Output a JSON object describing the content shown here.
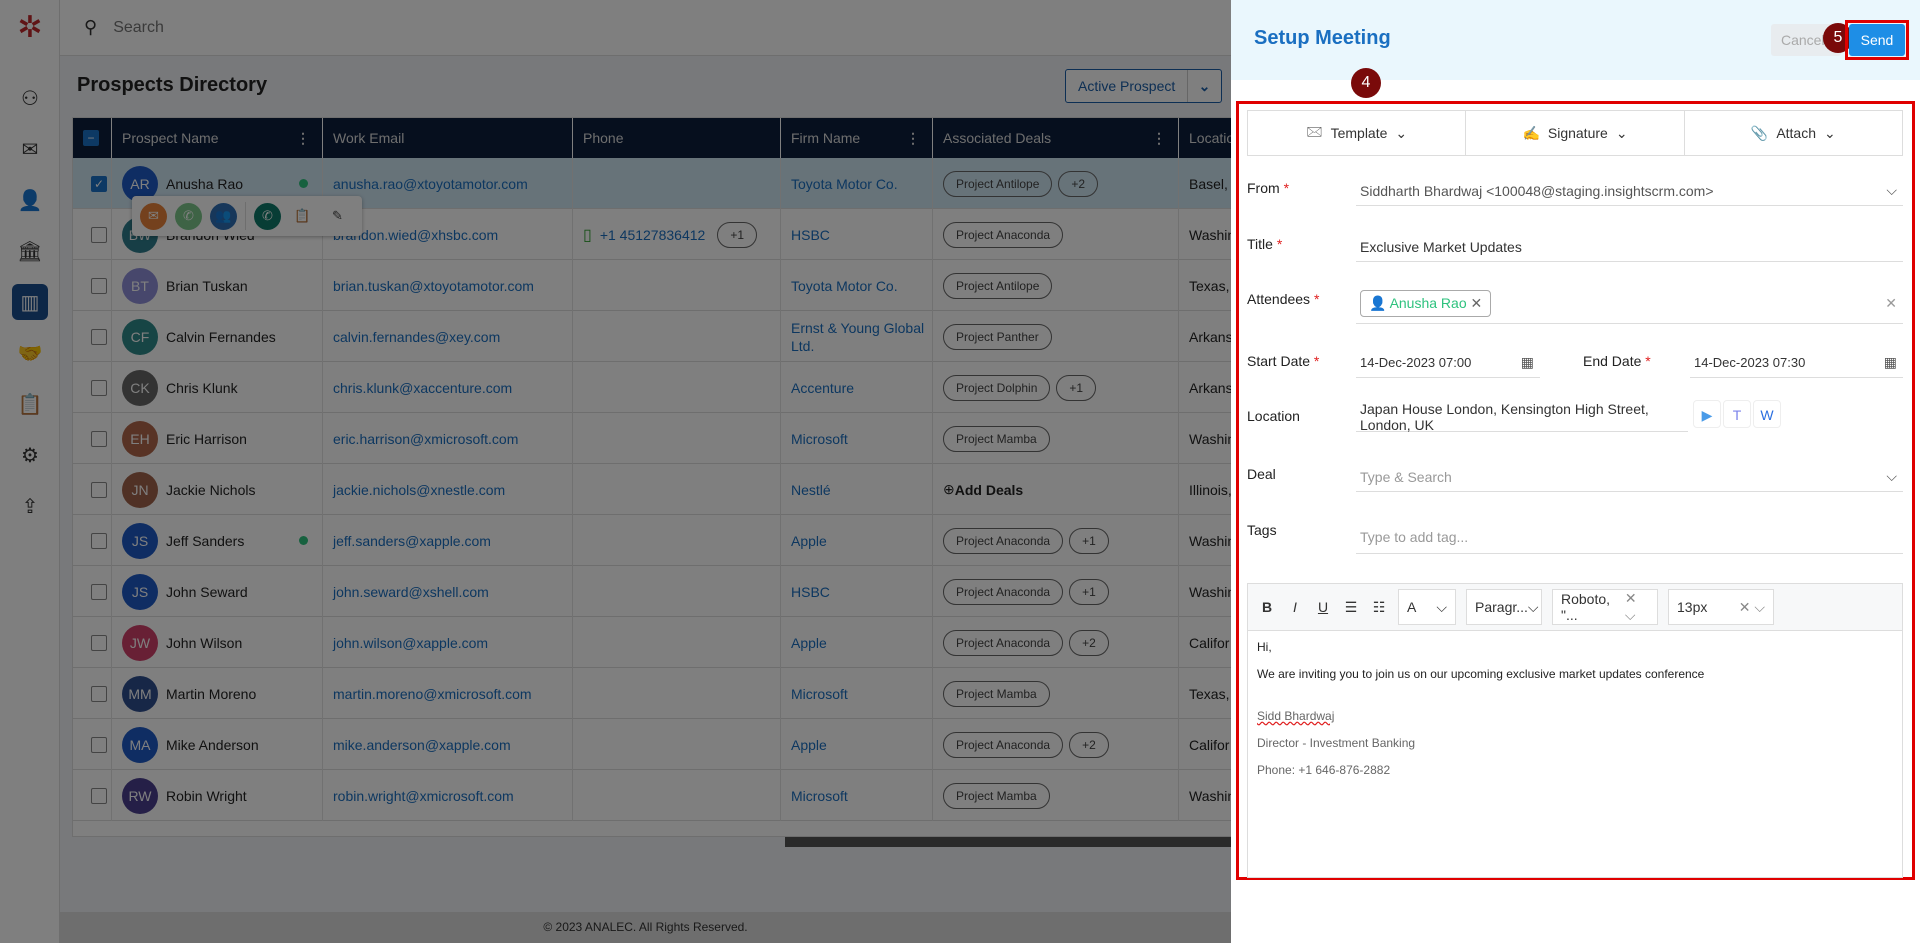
{
  "sidebar": {
    "items": [
      "prospects-icon",
      "mail-icon",
      "contacts-icon",
      "bank-icon",
      "analytics-icon",
      "handshake-icon",
      "clipboard-icon",
      "user-settings-icon",
      "user-share-icon"
    ],
    "active_index": 4
  },
  "search": {
    "placeholder": "Search"
  },
  "page": {
    "title": "Prospects Directory",
    "filter": "Active Prospect"
  },
  "table": {
    "columns": [
      "Prospect Name",
      "Work Email",
      "Phone",
      "Firm Name",
      "Associated Deals",
      "Location"
    ],
    "rows": [
      {
        "initials": "AR",
        "name": "Anusha Rao",
        "color": "#1e5bc6",
        "email": "anusha.rao@xtoyotamotor.com",
        "phone": "",
        "phone_extra": "",
        "firm": "Toyota Motor Co.",
        "deal": "Project Antilope",
        "deal_extra": "+2",
        "location": "Basel, S",
        "checked": true,
        "online": true
      },
      {
        "initials": "BW",
        "name": "Brandon Wied",
        "color": "#2e7d8c",
        "email": "brandon.wied@xhsbc.com",
        "phone": "+1 45127836412",
        "phone_extra": "+1",
        "firm": "HSBC",
        "deal": "Project Anaconda",
        "deal_extra": "",
        "location": "Washin",
        "checked": false,
        "online": false
      },
      {
        "initials": "BT",
        "name": "Brian Tuskan",
        "color": "#8e8ed8",
        "email": "brian.tuskan@xtoyotamotor.com",
        "phone": "",
        "phone_extra": "",
        "firm": "Toyota Motor Co.",
        "deal": "Project Antilope",
        "deal_extra": "",
        "location": "Texas,",
        "checked": false,
        "online": false
      },
      {
        "initials": "CF",
        "name": "Calvin Fernandes",
        "color": "#2f8a8a",
        "email": "calvin.fernandes@xey.com",
        "phone": "",
        "phone_extra": "",
        "firm": "Ernst & Young Global Ltd.",
        "deal": "Project Panther",
        "deal_extra": "",
        "location": "Arkans",
        "checked": false,
        "online": false
      },
      {
        "initials": "CK",
        "name": "Chris Klunk",
        "color": "#666666",
        "email": "chris.klunk@xaccenture.com",
        "phone": "",
        "phone_extra": "",
        "firm": "Accenture",
        "deal": "Project Dolphin",
        "deal_extra": "+1",
        "location": "Arkans",
        "checked": false,
        "online": false
      },
      {
        "initials": "EH",
        "name": "Eric Harrison",
        "color": "#b0664a",
        "email": "eric.harrison@xmicrosoft.com",
        "phone": "",
        "phone_extra": "",
        "firm": "Microsoft",
        "deal": "Project Mamba",
        "deal_extra": "",
        "location": "Washin",
        "checked": false,
        "online": false
      },
      {
        "initials": "JN",
        "name": "Jackie Nichols",
        "color": "#a0624a",
        "email": "jackie.nichols@xnestle.com",
        "phone": "",
        "phone_extra": "",
        "firm": "Nestlé",
        "deal": "",
        "deal_extra": "",
        "add_deals": "Add Deals",
        "location": "Illinois,",
        "checked": false,
        "online": false
      },
      {
        "initials": "JS",
        "name": "Jeff Sanders",
        "color": "#1e5bc6",
        "email": "jeff.sanders@xapple.com",
        "phone": "",
        "phone_extra": "",
        "firm": "Apple",
        "deal": "Project Anaconda",
        "deal_extra": "+1",
        "location": "Washin",
        "checked": false,
        "online": true
      },
      {
        "initials": "JS",
        "name": "John Seward",
        "color": "#1e5bc6",
        "email": "john.seward@xshell.com",
        "phone": "",
        "phone_extra": "",
        "firm": "HSBC",
        "deal": "Project Anaconda",
        "deal_extra": "+1",
        "location": "Washin",
        "checked": false,
        "online": false
      },
      {
        "initials": "JW",
        "name": "John Wilson",
        "color": "#d0406a",
        "email": "john.wilson@xapple.com",
        "phone": "",
        "phone_extra": "",
        "firm": "Apple",
        "deal": "Project Anaconda",
        "deal_extra": "+2",
        "location": "Califor",
        "checked": false,
        "online": false
      },
      {
        "initials": "MM",
        "name": "Martin Moreno",
        "color": "#2f4f8f",
        "email": "martin.moreno@xmicrosoft.com",
        "phone": "",
        "phone_extra": "",
        "firm": "Microsoft",
        "deal": "Project Mamba",
        "deal_extra": "",
        "location": "Texas,",
        "checked": false,
        "online": false
      },
      {
        "initials": "MA",
        "name": "Mike Anderson",
        "color": "#1e5bc6",
        "email": "mike.anderson@xapple.com",
        "phone": "",
        "phone_extra": "",
        "firm": "Apple",
        "deal": "Project Anaconda",
        "deal_extra": "+2",
        "location": "Califor",
        "checked": false,
        "online": false
      },
      {
        "initials": "RW",
        "name": "Robin Wright",
        "color": "#4a3f8f",
        "email": "robin.wright@xmicrosoft.com",
        "phone": "",
        "phone_extra": "",
        "firm": "Microsoft",
        "deal": "Project Mamba",
        "deal_extra": "",
        "location": "Washin",
        "checked": false,
        "online": false
      }
    ]
  },
  "hover_actions": [
    "email-icon",
    "call-icon",
    "meeting-icon",
    "call-log-icon",
    "add-task-icon",
    "edit-icon"
  ],
  "footer": "© 2023 ANALEC. All Rights Reserved.",
  "panel": {
    "title": "Setup Meeting",
    "cancel": "Cancel",
    "send": "Send",
    "badge_4": "4",
    "badge_5": "5",
    "toolbar": {
      "template": "Template",
      "signature": "Signature",
      "attach": "Attach"
    },
    "from": {
      "label": "From",
      "value": "Siddharth Bhardwaj <100048@staging.insightscrm.com>"
    },
    "title_field": {
      "label": "Title",
      "value": "Exclusive Market Updates"
    },
    "attendees": {
      "label": "Attendees",
      "chip": "Anusha Rao"
    },
    "start": {
      "label": "Start Date",
      "value": "14-Dec-2023 07:00"
    },
    "end": {
      "label": "End Date",
      "value": "14-Dec-2023 07:30"
    },
    "location": {
      "label": "Location",
      "value": "Japan House London, Kensington High Street, London, UK"
    },
    "deal": {
      "label": "Deal",
      "placeholder": "Type & Search"
    },
    "tags": {
      "label": "Tags",
      "placeholder": "Type to add tag..."
    },
    "editor": {
      "paragraph": "Paragr...",
      "font": "Roboto, \"...",
      "size": "13px",
      "greeting": "Hi,",
      "body": "We are inviting you to join us on our upcoming exclusive market updates conference",
      "sig_name": "Sidd Bhardwaj",
      "sig_title": "Director - Investment Banking",
      "sig_phone": "Phone: +1 646-876-2882"
    }
  }
}
